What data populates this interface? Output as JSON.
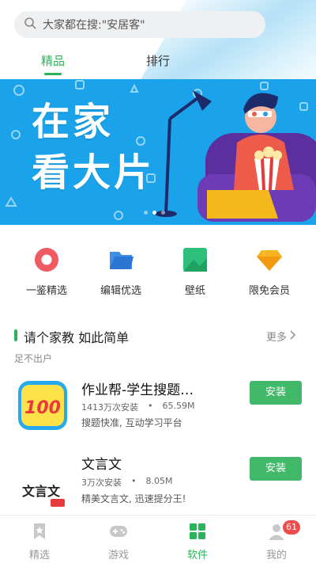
{
  "search": {
    "placeholder_text": "大家都在搜:\"安居客\""
  },
  "tabs": [
    {
      "label": "精品",
      "active": true
    },
    {
      "label": "排行",
      "active": false
    }
  ],
  "banner": {
    "line1": "在家",
    "line2": "看大片",
    "background": "#1aa3ea"
  },
  "categories": [
    {
      "label": "一鉴精选",
      "icon": "ring-icon"
    },
    {
      "label": "编辑优选",
      "icon": "folder-icon"
    },
    {
      "label": "壁纸",
      "icon": "image-icon"
    },
    {
      "label": "限免会员",
      "icon": "diamond-icon"
    }
  ],
  "section": {
    "title": "请个家教 如此简单",
    "more": "更多",
    "subtitle": "足不出户"
  },
  "apps": [
    {
      "name": "作业帮-学生搜题…",
      "installs": "1413万次安装",
      "size": "65.59M",
      "desc": "搜题快准, 互动学习平台",
      "button": "安装",
      "icon": "homework-app-icon"
    },
    {
      "name": "文言文",
      "installs": "3万次安装",
      "size": "8.05M",
      "desc": "精美文言文, 迅速提分王!",
      "button": "安装",
      "icon": "wenyanwen-app-icon"
    }
  ],
  "bottom_nav": [
    {
      "label": "精选",
      "active": false
    },
    {
      "label": "游戏",
      "active": false
    },
    {
      "label": "软件",
      "active": true
    },
    {
      "label": "我的",
      "active": false,
      "badge": "61"
    }
  ],
  "colors": {
    "accent": "#2bb35b",
    "install": "#42b86a",
    "badge": "#ef4d4d"
  }
}
